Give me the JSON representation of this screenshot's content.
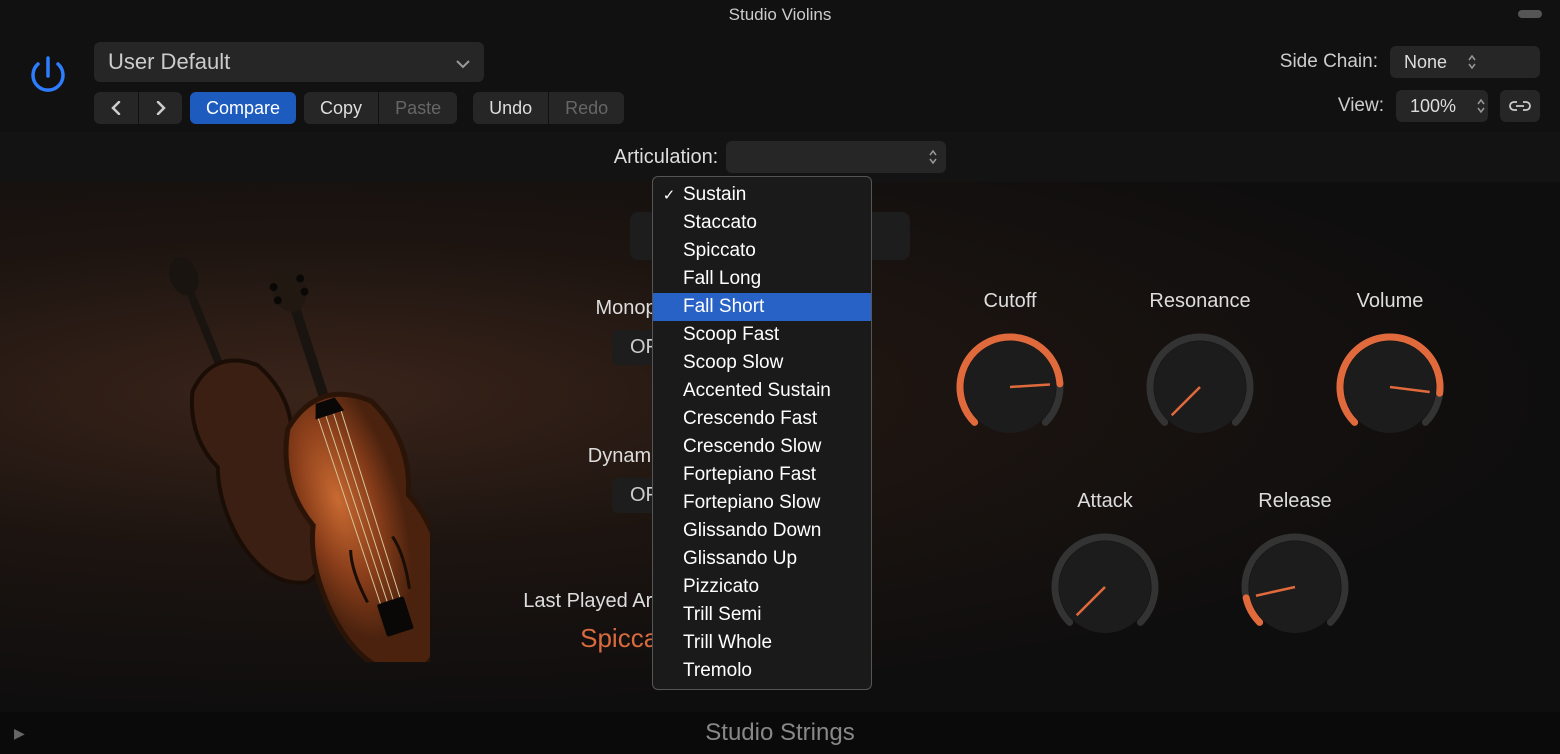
{
  "title": "Studio Violins",
  "preset": {
    "name": "User Default"
  },
  "toolbar": {
    "compare": "Compare",
    "copy": "Copy",
    "paste": "Paste",
    "undo": "Undo",
    "redo": "Redo"
  },
  "sidechain": {
    "label": "Side Chain:",
    "value": "None"
  },
  "view": {
    "label": "View:",
    "value": "100%"
  },
  "articulation": {
    "label": "Articulation:"
  },
  "params": {
    "monophonic": {
      "label": "Monophonic",
      "value": "OFF"
    },
    "dynamics_ctrl": {
      "label": "Dynamics Ctrl",
      "value": "OFF"
    },
    "last_played": {
      "label": "Last Played Articulation:",
      "value": "Spiccato"
    }
  },
  "knobs": {
    "cutoff": {
      "label": "Cutoff",
      "fill": 0.82,
      "color": "#e06a3c"
    },
    "resonance": {
      "label": "Resonance",
      "fill": 0.0,
      "color": "#e06a3c"
    },
    "volume": {
      "label": "Volume",
      "fill": 0.86,
      "color": "#e06a3c"
    },
    "attack": {
      "label": "Attack",
      "fill": 0.0,
      "color": "#e06a3c"
    },
    "release": {
      "label": "Release",
      "fill": 0.12,
      "color": "#e06a3c"
    }
  },
  "dropdown": {
    "checked": "Sustain",
    "highlighted": "Fall Short",
    "items": [
      "Sustain",
      "Staccato",
      "Spiccato",
      "Fall Long",
      "Fall Short",
      "Scoop Fast",
      "Scoop Slow",
      "Accented Sustain",
      "Crescendo Fast",
      "Crescendo Slow",
      "Fortepiano Fast",
      "Fortepiano Slow",
      "Glissando Down",
      "Glissando Up",
      "Pizzicato",
      "Trill Semi",
      "Trill Whole",
      "Tremolo"
    ]
  },
  "footer": "Studio Strings"
}
